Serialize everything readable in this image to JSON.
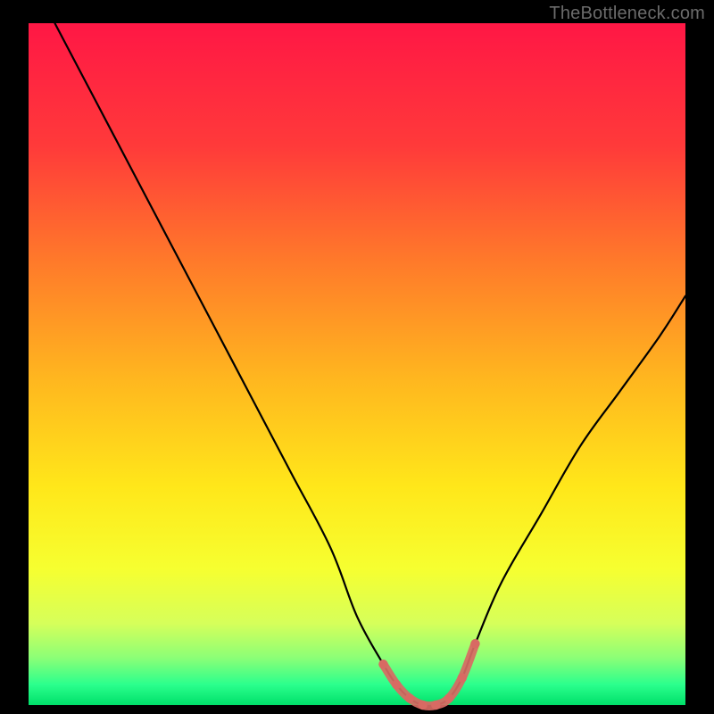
{
  "watermark": "TheBottleneck.com",
  "chart_data": {
    "type": "line",
    "title": "",
    "xlabel": "",
    "ylabel": "",
    "xlim": [
      0,
      100
    ],
    "ylim": [
      0,
      100
    ],
    "grid": false,
    "legend": false,
    "gradient_stops": [
      {
        "offset": 0,
        "color": "#ff1745"
      },
      {
        "offset": 18,
        "color": "#ff3a3a"
      },
      {
        "offset": 35,
        "color": "#ff7a2a"
      },
      {
        "offset": 52,
        "color": "#ffb61f"
      },
      {
        "offset": 68,
        "color": "#ffe71a"
      },
      {
        "offset": 80,
        "color": "#f6ff30"
      },
      {
        "offset": 88,
        "color": "#d6ff5a"
      },
      {
        "offset": 93,
        "color": "#8dff76"
      },
      {
        "offset": 97,
        "color": "#2bff8d"
      },
      {
        "offset": 100,
        "color": "#00e06a"
      }
    ],
    "series": [
      {
        "name": "bottleneck-curve",
        "stroke": "#000000",
        "x": [
          4,
          10,
          16,
          22,
          28,
          34,
          40,
          46,
          50,
          54,
          56,
          58,
          60,
          62,
          64,
          66,
          68,
          72,
          78,
          84,
          90,
          96,
          100
        ],
        "values": [
          100,
          89,
          78,
          67,
          56,
          45,
          34,
          23,
          13,
          6,
          3,
          1,
          0,
          0,
          1,
          4,
          9,
          18,
          28,
          38,
          46,
          54,
          60
        ]
      },
      {
        "name": "optimal-zone-marker",
        "stroke": "#d86a63",
        "x": [
          54,
          56,
          58,
          60,
          62,
          64,
          66,
          68
        ],
        "values": [
          6,
          3,
          1,
          0,
          0,
          1,
          4,
          9
        ]
      }
    ]
  }
}
